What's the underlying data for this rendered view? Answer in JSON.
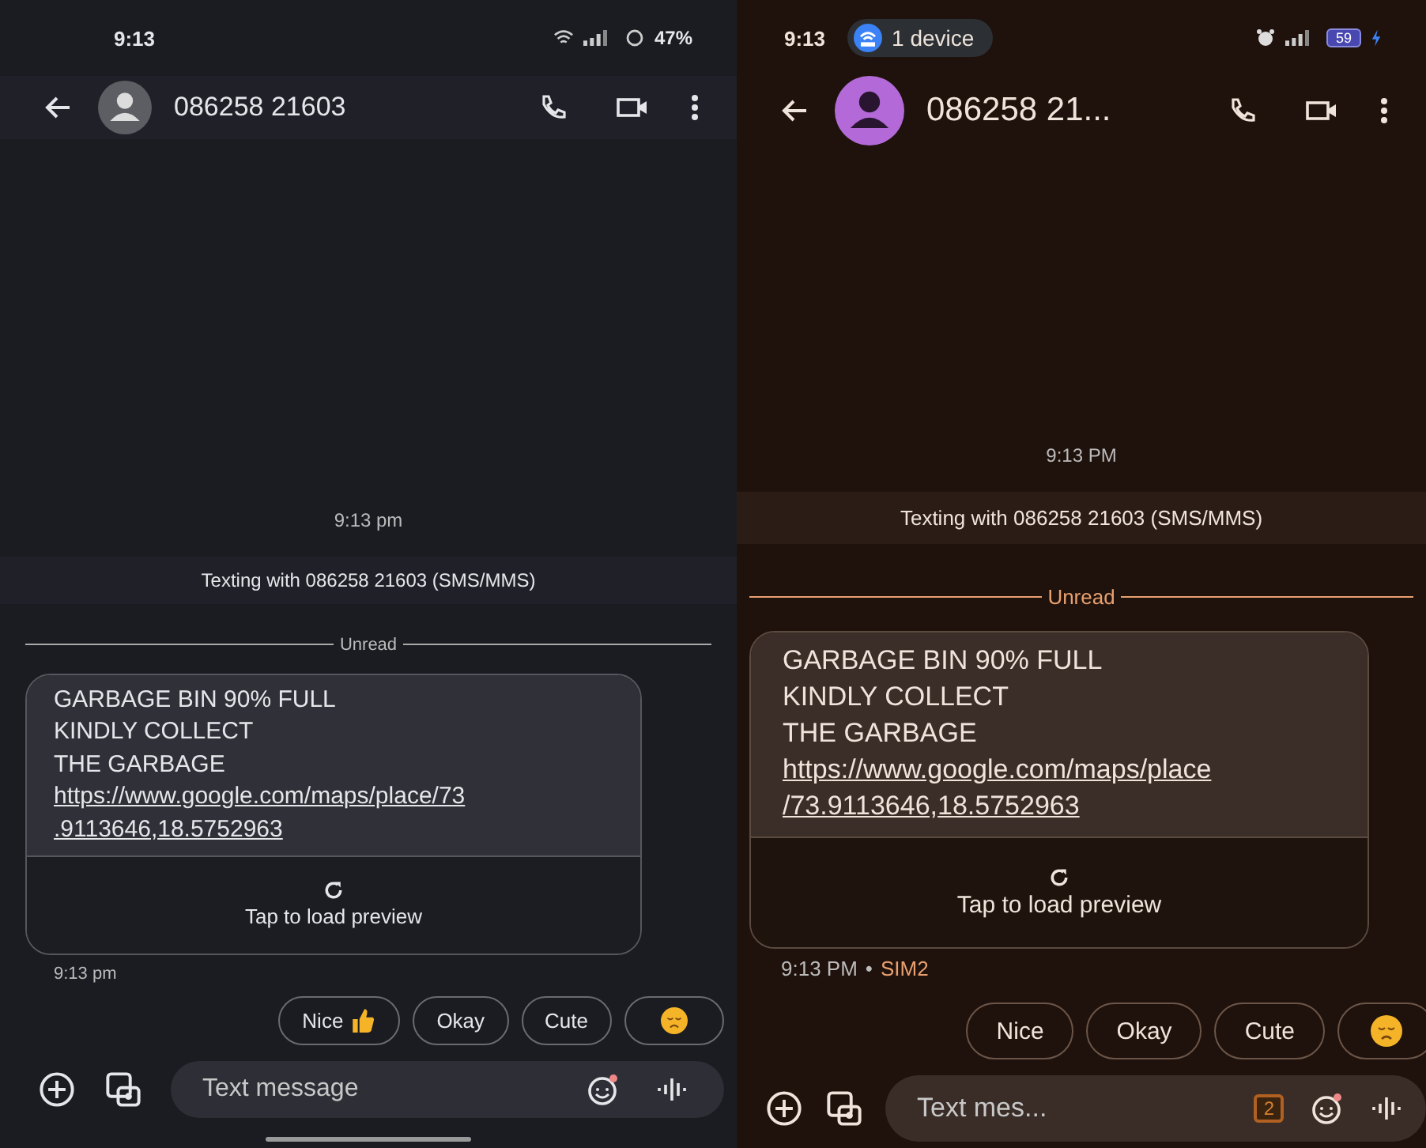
{
  "phones": [
    {
      "kind": "dark",
      "status_bar": {
        "time": "9:13",
        "battery": "47%"
      },
      "header": {
        "contact": "086258 21603"
      },
      "timestamp": "9:13 pm",
      "banner": "Texting with 086258 21603 (SMS/MMS)",
      "divider": "Unread",
      "message": {
        "lines": [
          "GARBAGE BIN 90% FULL",
          "KINDLY COLLECT",
          "THE GARBAGE"
        ],
        "link_lines": [
          "https://www.google.com/maps/place/73",
          ".9113646,18.5752963"
        ],
        "preview": "Tap to load preview"
      },
      "footer": {
        "time": "9:13 pm"
      },
      "chips": [
        {
          "kind": "text_thumb",
          "label": "Nice"
        },
        {
          "kind": "text",
          "label": "Okay"
        },
        {
          "kind": "text",
          "label": "Cute"
        },
        {
          "kind": "emoji"
        }
      ],
      "input": {
        "placeholder": "Text message"
      }
    },
    {
      "kind": "brown",
      "status_bar": {
        "time": "9:13",
        "pill": "1 device",
        "battery": "59"
      },
      "header": {
        "contact": "086258 21..."
      },
      "timestamp": "9:13 PM",
      "banner": "Texting with 086258 21603 (SMS/MMS)",
      "divider": "Unread",
      "message": {
        "lines": [
          "GARBAGE BIN 90% FULL",
          "KINDLY COLLECT",
          "THE GARBAGE"
        ],
        "link_lines": [
          "https://www.google.com/maps/place",
          "/73.9113646,18.5752963"
        ],
        "preview": "Tap to load preview"
      },
      "footer": {
        "time": "9:13 PM",
        "separator": "•",
        "sim": "SIM2"
      },
      "chips": [
        {
          "kind": "text",
          "label": "Nice"
        },
        {
          "kind": "text",
          "label": "Okay"
        },
        {
          "kind": "text",
          "label": "Cute"
        },
        {
          "kind": "emoji"
        }
      ],
      "input": {
        "placeholder": "Text mes...",
        "sim_badge": "2"
      }
    }
  ]
}
